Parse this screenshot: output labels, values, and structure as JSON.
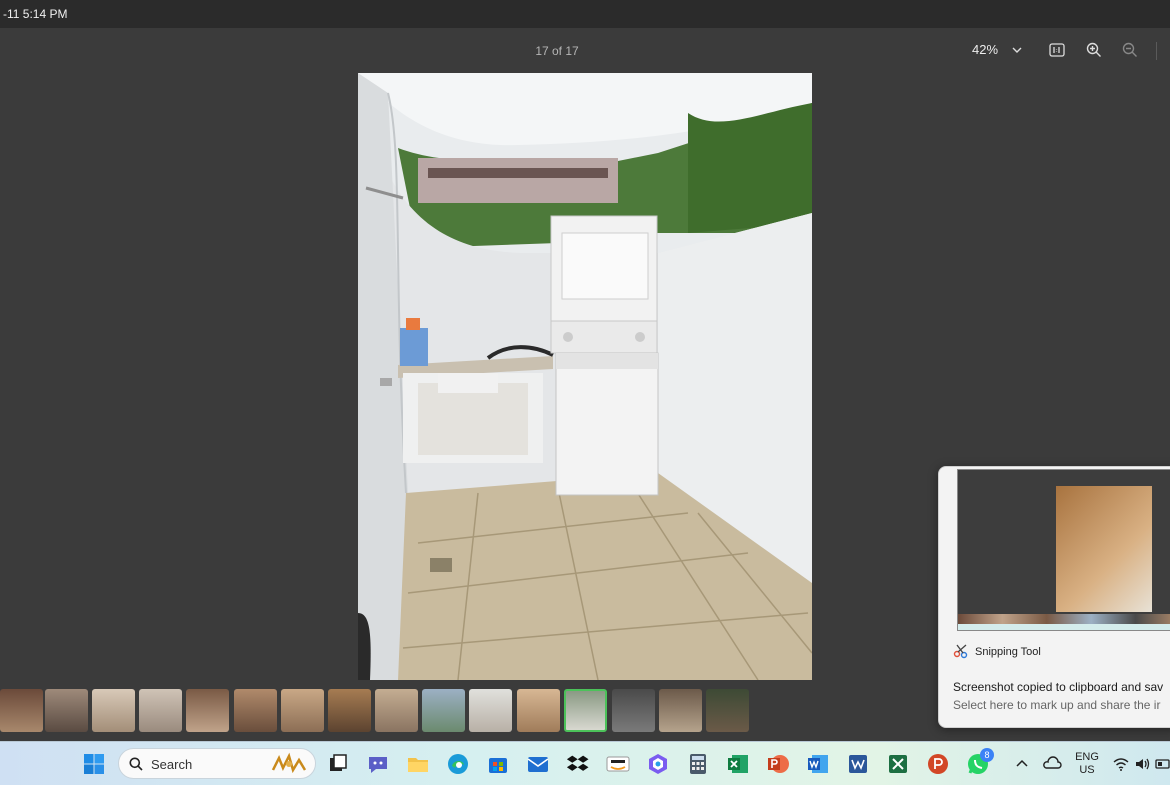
{
  "titlebar": {
    "time_text": "-11 5:14 PM"
  },
  "toolbar": {
    "counter": "17 of 17",
    "zoom_level": "42%",
    "icons": [
      "chevron-down-icon",
      "actual-size-icon",
      "zoom-in-icon",
      "zoom-out-icon"
    ]
  },
  "photo": {
    "subject": "laundry area with stacked washer-dryer and utility sink"
  },
  "filmstrip": {
    "count": 16,
    "selected_index": 12
  },
  "toast": {
    "app_name": "Snipping Tool",
    "message": "Screenshot copied to clipboard and sav",
    "sub_message": "Select here to mark up and share the ir"
  },
  "taskbar": {
    "search_placeholder": "Search",
    "language_top": "ENG",
    "language_bottom": "US",
    "whatsapp_badge": "8",
    "pinned_apps": [
      "start",
      "search",
      "task-view",
      "teams",
      "file-explorer",
      "edge",
      "store",
      "mail",
      "dropbox",
      "amazon",
      "copilot",
      "calculator",
      "excel",
      "powerpoint",
      "word",
      "word-alt",
      "excel-alt",
      "powerpoint-alt",
      "whatsapp"
    ]
  },
  "colors": {
    "accent_green": "#4cc25a",
    "viewer_bg": "#3b3b3b"
  }
}
